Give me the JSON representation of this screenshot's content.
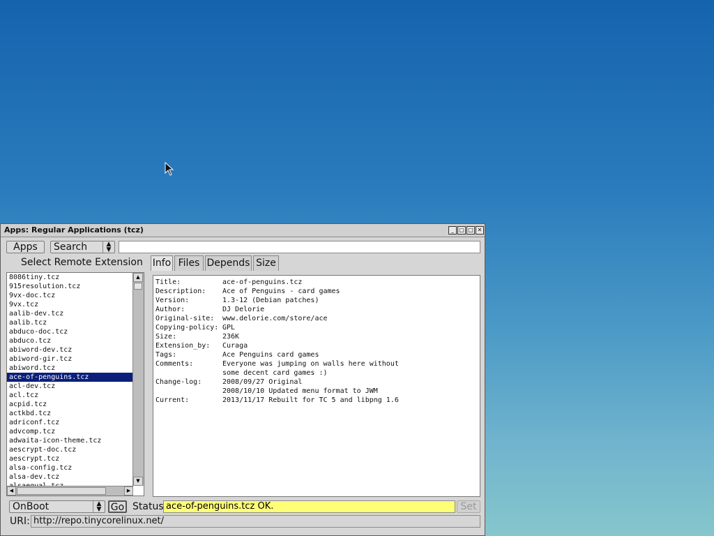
{
  "window": {
    "title": "Apps: Regular Applications (tcz)",
    "controls": {
      "minimize": "_",
      "restore": "▢",
      "maximize": "□",
      "close": "✕"
    }
  },
  "toolbar": {
    "apps_label": "Apps",
    "search_mode": "Search",
    "search_value": ""
  },
  "left_panel": {
    "heading": "Select Remote Extension",
    "items": [
      "8086tiny.tcz",
      "915resolution.tcz",
      "9vx-doc.tcz",
      "9vx.tcz",
      "aalib-dev.tcz",
      "aalib.tcz",
      "abduco-doc.tcz",
      "abduco.tcz",
      "abiword-dev.tcz",
      "abiword-gir.tcz",
      "abiword.tcz",
      "ace-of-penguins.tcz",
      "acl-dev.tcz",
      "acl.tcz",
      "acpid.tcz",
      "actkbd.tcz",
      "adriconf.tcz",
      "advcomp.tcz",
      "adwaita-icon-theme.tcz",
      "aescrypt-doc.tcz",
      "aescrypt.tcz",
      "alsa-config.tcz",
      "alsa-dev.tcz",
      "alsaequal.tcz"
    ],
    "selected_index": 11
  },
  "tabs": [
    {
      "label": "Info",
      "active": true
    },
    {
      "label": "Files",
      "active": false
    },
    {
      "label": "Depends",
      "active": false
    },
    {
      "label": "Size",
      "active": false
    }
  ],
  "info": [
    {
      "key": "Title:",
      "value": "ace-of-penguins.tcz"
    },
    {
      "key": "Description:",
      "value": "Ace of Penguins - card games"
    },
    {
      "key": "Version:",
      "value": "1.3-12 (Debian patches)"
    },
    {
      "key": "Author:",
      "value": "DJ Delorie"
    },
    {
      "key": "Original-site:",
      "value": "www.delorie.com/store/ace"
    },
    {
      "key": "Copying-policy:",
      "value": "GPL"
    },
    {
      "key": "Size:",
      "value": "236K"
    },
    {
      "key": "Extension_by:",
      "value": "Curaga"
    },
    {
      "key": "Tags:",
      "value": "Ace Penguins card games"
    },
    {
      "key": "Comments:",
      "value": "Everyone was jumping on walls here without"
    },
    {
      "key": "",
      "value": "some decent card games :)"
    },
    {
      "key": "Change-log:",
      "value": "2008/09/27 Original"
    },
    {
      "key": "",
      "value": "2008/10/10 Updated menu format to JWM"
    },
    {
      "key": "Current:",
      "value": "2013/11/17 Rebuilt for TC 5 and libpng 1.6"
    }
  ],
  "bottom": {
    "install_mode": "OnBoot",
    "go_label": "Go",
    "status_label": "Status",
    "status_text": "ace-of-penguins.tcz OK.",
    "set_label": "Set",
    "uri_label": "URI:",
    "uri_value": "http://repo.tinycorelinux.net/"
  }
}
